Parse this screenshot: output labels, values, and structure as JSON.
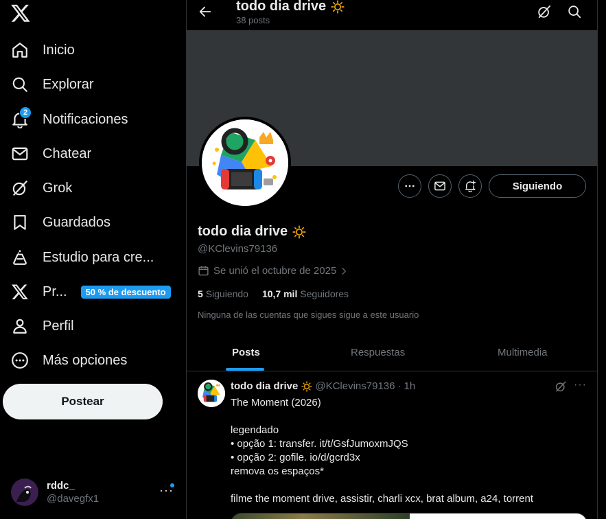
{
  "nav": {
    "items": [
      {
        "label": "Inicio",
        "icon": "home-icon"
      },
      {
        "label": "Explorar",
        "icon": "search-icon"
      },
      {
        "label": "Notificaciones",
        "icon": "bell-icon",
        "badge": "2"
      },
      {
        "label": "Chatear",
        "icon": "mail-icon"
      },
      {
        "label": "Grok",
        "icon": "grok-icon"
      },
      {
        "label": "Guardados",
        "icon": "bookmark-icon"
      },
      {
        "label": "Estudio para cre...",
        "icon": "flask-icon"
      },
      {
        "label": "Pr...",
        "icon": "x-premium-icon",
        "promo": "50 % de descuento"
      },
      {
        "label": "Perfil",
        "icon": "person-icon"
      },
      {
        "label": "Más opciones",
        "icon": "more-circle-icon"
      }
    ],
    "post_button": "Postear"
  },
  "account": {
    "name": "rddc_",
    "handle": "@davegfx1"
  },
  "header": {
    "title": "todo dia drive",
    "posts_count": "38 posts"
  },
  "profile": {
    "name": "todo dia drive",
    "handle": "@KClevins79136",
    "joined": "Se unió el octubre de 2025",
    "following_count": "5",
    "following_label": "Siguiendo",
    "followers_count": "10,7 mil",
    "followers_label": "Seguidores",
    "note": "Ninguna de las cuentas que sigues sigue a este usuario",
    "follow_button": "Siguiendo"
  },
  "tabs": [
    "Posts",
    "Respuestas",
    "Multimedia"
  ],
  "tweet": {
    "name": "todo dia drive",
    "handle": "@KClevins79136",
    "time": "1h",
    "lines": [
      "The Moment (2026)",
      "",
      "legendado",
      "• opção 1: transfer. it/t/GsfJumoxmJQS",
      "• opção 2: gofile. io/d/gcrd3x",
      "remova os espaços*",
      "",
      "filme the moment drive, assistir, charli xcx, brat album, a24, torrent"
    ]
  },
  "colors": {
    "accent": "#1d9bf0",
    "background": "#000000",
    "banner": "#333639",
    "muted": "#71767b",
    "sun_emoji": "#f4a900"
  }
}
